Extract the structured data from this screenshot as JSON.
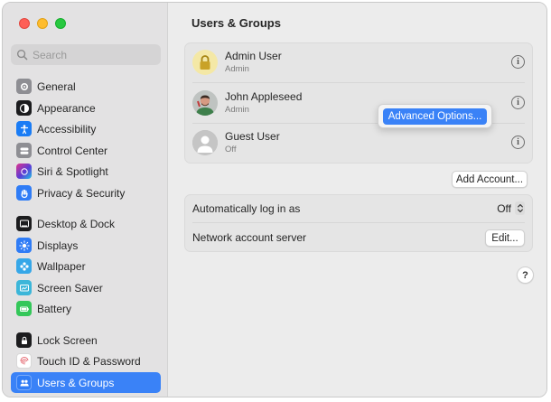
{
  "search": {
    "placeholder": "Search"
  },
  "sidebar": {
    "items": [
      {
        "label": "General",
        "icon": "gear-icon",
        "color": "#8e8e93"
      },
      {
        "label": "Appearance",
        "icon": "appearance-icon",
        "color": "#1c1c1e"
      },
      {
        "label": "Accessibility",
        "icon": "accessibility-icon",
        "color": "#1a7cf5"
      },
      {
        "label": "Control Center",
        "icon": "control-center-icon",
        "color": "#8e8e93"
      },
      {
        "label": "Siri & Spotlight",
        "icon": "siri-icon",
        "color": "#5b3dd6"
      },
      {
        "label": "Privacy & Security",
        "icon": "hand-icon",
        "color": "#2f7cf6"
      },
      {
        "label": "Desktop & Dock",
        "icon": "dock-icon",
        "color": "#1c1c1e"
      },
      {
        "label": "Displays",
        "icon": "sun-icon",
        "color": "#2f7cf6"
      },
      {
        "label": "Wallpaper",
        "icon": "wallpaper-icon",
        "color": "#36a7e8"
      },
      {
        "label": "Screen Saver",
        "icon": "screen-saver-icon",
        "color": "#3cb6d9"
      },
      {
        "label": "Battery",
        "icon": "battery-icon",
        "color": "#34c759"
      },
      {
        "label": "Lock Screen",
        "icon": "lock-icon",
        "color": "#1c1c1e"
      },
      {
        "label": "Touch ID & Password",
        "icon": "fingerprint-icon",
        "color": "#ffffff"
      },
      {
        "label": "Users & Groups",
        "icon": "users-icon",
        "color": "#2f7cf6"
      }
    ]
  },
  "main": {
    "title": "Users & Groups",
    "users": [
      {
        "name": "Admin User",
        "role": "Admin",
        "avatar": "lock-avatar-icon"
      },
      {
        "name": "John Appleseed",
        "role": "Admin",
        "avatar": "person-photo-avatar"
      },
      {
        "name": "Guest User",
        "role": "Off",
        "avatar": "generic-person-icon"
      }
    ],
    "popup_option": "Advanced Options...",
    "add_account": "Add Account...",
    "settings": {
      "auto_login_label": "Automatically log in as",
      "auto_login_value": "Off",
      "network_label": "Network account server",
      "edit_button": "Edit..."
    },
    "help": "?"
  },
  "colors": {
    "accent": "#3a82f7"
  }
}
